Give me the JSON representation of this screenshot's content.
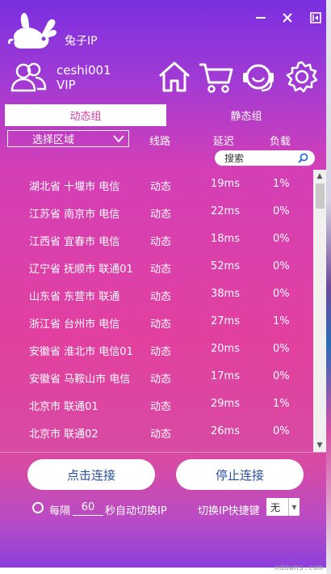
{
  "window": {
    "title": "兔子IP",
    "minimize_label": "—",
    "close_label": "✕",
    "side_label": "⇤"
  },
  "user": {
    "name": "ceshi001",
    "level": "VIP"
  },
  "nav": {
    "icons": [
      "home-icon",
      "cart-icon",
      "headset-icon",
      "gear-icon"
    ]
  },
  "tabs": [
    {
      "label": "动态组",
      "active": true
    },
    {
      "label": "静态组",
      "active": false
    }
  ],
  "filter": {
    "region_select": "选择区域",
    "col_line": "线路",
    "col_delay": "延迟",
    "col_load": "负载",
    "search_placeholder": "搜索"
  },
  "servers": [
    {
      "region": "湖北省 十堰市 电信",
      "type": "动态",
      "delay": "19ms",
      "load": "1%"
    },
    {
      "region": "江苏省 南京市 电信",
      "type": "动态",
      "delay": "22ms",
      "load": "0%"
    },
    {
      "region": "江西省 宜春市 电信",
      "type": "动态",
      "delay": "18ms",
      "load": "0%"
    },
    {
      "region": "辽宁省 抚顺市 联通01",
      "type": "动态",
      "delay": "52ms",
      "load": "0%"
    },
    {
      "region": "山东省 东营市 联通",
      "type": "动态",
      "delay": "38ms",
      "load": "0%"
    },
    {
      "region": "浙江省 台州市 电信",
      "type": "动态",
      "delay": "27ms",
      "load": "1%"
    },
    {
      "region": "安徽省 淮北市 电信01",
      "type": "动态",
      "delay": "20ms",
      "load": "0%"
    },
    {
      "region": "安徽省 马鞍山市 电信",
      "type": "动态",
      "delay": "17ms",
      "load": "0%"
    },
    {
      "region": "北京市 联通01",
      "type": "动态",
      "delay": "29ms",
      "load": "1%"
    },
    {
      "region": "北京市 联通02",
      "type": "动态",
      "delay": "26ms",
      "load": "0%"
    }
  ],
  "actions": {
    "connect": "点击连接",
    "stop": "停止连接"
  },
  "auto_switch": {
    "every": "每隔",
    "interval": "60",
    "suffix": "秒自动切换IP",
    "hotkey_label": "切换IP快捷键",
    "hotkey_value": "无"
  },
  "watermark": "xdowns.com",
  "colors": {
    "accent": "#e2409f",
    "tab_text": "#d63aa0",
    "button_text": "#2a4f9a"
  }
}
